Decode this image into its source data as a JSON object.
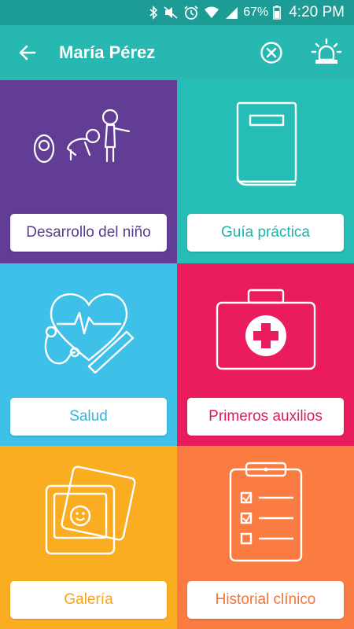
{
  "status_bar": {
    "battery": "67%",
    "time": "4:20 PM",
    "icons": [
      "bluetooth-icon",
      "mute-icon",
      "alarm-clock-icon",
      "wifi-icon",
      "signal-icon",
      "battery-icon"
    ]
  },
  "app_bar": {
    "title": "María Pérez",
    "back_icon": "arrow-left-icon",
    "close_icon": "close-circle-icon",
    "emergency_icon": "siren-icon"
  },
  "tiles": [
    {
      "label": "Desarrollo del niño",
      "icon": "baby-growth-icon",
      "color": "#613d95",
      "text_color": "#5b3a8e"
    },
    {
      "label": "Guía práctica",
      "icon": "book-icon",
      "color": "#26bdb6",
      "text_color": "#1fb3ac"
    },
    {
      "label": "Salud",
      "icon": "health-icon",
      "color": "#3ec0e8",
      "text_color": "#33b6e0"
    },
    {
      "label": "Primeros auxilios",
      "icon": "first-aid-kit-icon",
      "color": "#ea1c5d",
      "text_color": "#e11a57"
    },
    {
      "label": "Galería",
      "icon": "gallery-icon",
      "color": "#fbad22",
      "text_color": "#f4a41a"
    },
    {
      "label": "Historial clínico",
      "icon": "clipboard-icon",
      "color": "#fb7c43",
      "text_color": "#f1733a"
    }
  ],
  "colors": {
    "status_bar": "#1d9c96",
    "app_bar": "#26b8b1"
  }
}
